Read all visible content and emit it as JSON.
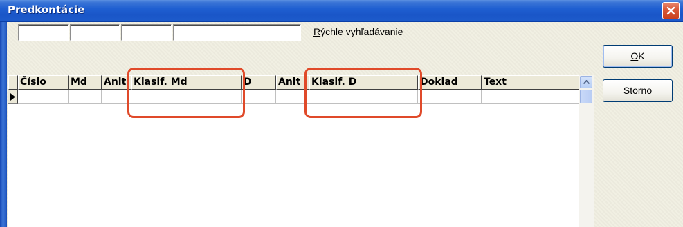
{
  "window": {
    "title": "Predkontácie"
  },
  "search": {
    "label_accel": "R",
    "label_rest": "ýchle vyhľadávanie",
    "fields": [
      "",
      "",
      "",
      ""
    ]
  },
  "grid": {
    "columns": [
      "Číslo",
      "Md",
      "Anlt",
      "Klasif. Md",
      "D",
      "Anlt",
      "Klasif. D",
      "Doklad",
      "Text"
    ],
    "rows": [
      [
        "",
        "",
        "",
        "",
        "",
        "",
        "",
        "",
        ""
      ]
    ]
  },
  "buttons": {
    "ok_accel": "O",
    "ok_rest": "K",
    "cancel": "Storno"
  },
  "colors": {
    "titlebar": "#1f5fd1",
    "highlight": "#e04a2a",
    "window_bg": "#ece9d8"
  },
  "icons": {
    "close": "close-icon",
    "row_pointer": "row-pointer-icon",
    "scroll_up": "scroll-up-icon"
  }
}
